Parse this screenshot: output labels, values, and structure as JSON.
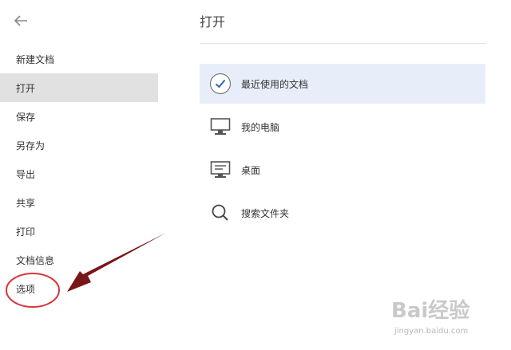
{
  "sidebar": {
    "back_icon": "arrow-left-icon",
    "items": [
      {
        "label": "新建文档",
        "active": false
      },
      {
        "label": "打开",
        "active": true
      },
      {
        "label": "保存",
        "active": false
      },
      {
        "label": "另存为",
        "active": false
      },
      {
        "label": "导出",
        "active": false
      },
      {
        "label": "共享",
        "active": false
      },
      {
        "label": "打印",
        "active": false
      },
      {
        "label": "文档信息",
        "active": false
      },
      {
        "label": "选项",
        "active": false
      }
    ]
  },
  "main": {
    "title": "打开",
    "locations": [
      {
        "label": "最近使用的文档",
        "icon": "checkmark-circle-icon",
        "selected": true
      },
      {
        "label": "我的电脑",
        "icon": "monitor-icon",
        "selected": false
      },
      {
        "label": "桌面",
        "icon": "desktop-icon",
        "selected": false
      },
      {
        "label": "搜索文件夹",
        "icon": "search-icon",
        "selected": false
      }
    ]
  },
  "annotation": {
    "arrow_color": "#7a1618",
    "circle_color": "#d9353a"
  },
  "watermark": {
    "brand": "Bai经验",
    "url": "jingyan.baidu.com"
  }
}
